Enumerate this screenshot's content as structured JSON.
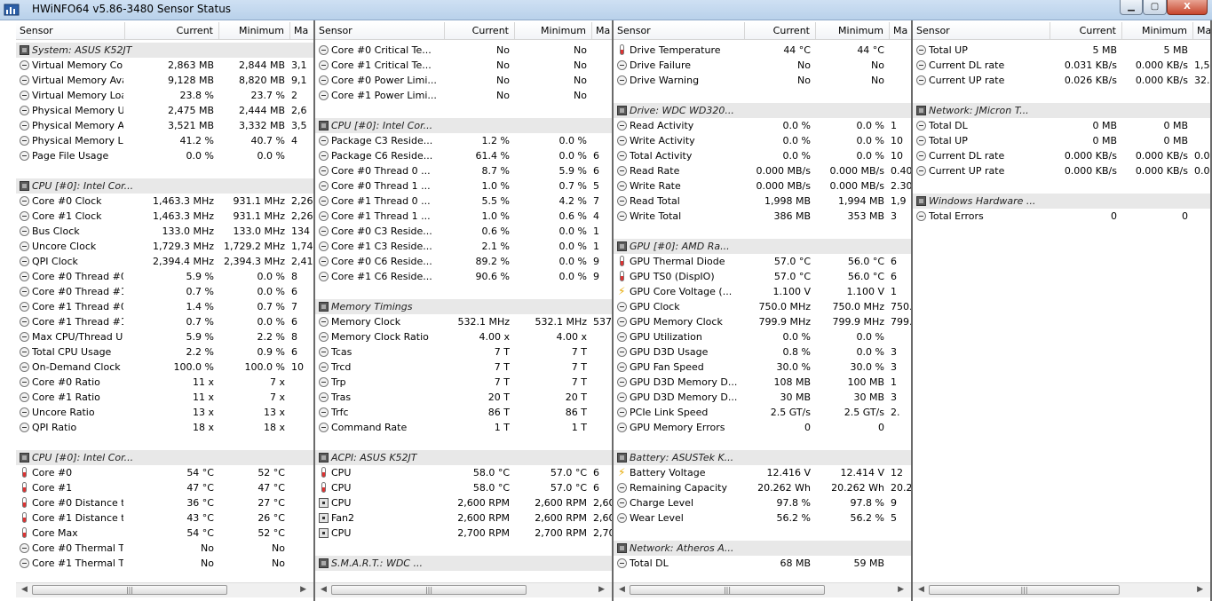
{
  "window": {
    "title": "HWiNFO64 v5.86-3480 Sensor Status",
    "min_label": "▁",
    "max_label": "▢",
    "close_label": "X"
  },
  "columns": [
    "Sensor",
    "Current",
    "Minimum",
    "Ma"
  ],
  "panels": [
    {
      "rows": [
        {
          "t": "g",
          "n": "System: ASUS K52JT",
          "i": "chip"
        },
        {
          "t": "s",
          "n": "Virtual Memory Com...",
          "c": "2,863 MB",
          "m": "2,844 MB",
          "x": "3,1",
          "i": "clock"
        },
        {
          "t": "s",
          "n": "Virtual Memory Avai...",
          "c": "9,128 MB",
          "m": "8,820 MB",
          "x": "9,1",
          "i": "clock"
        },
        {
          "t": "s",
          "n": "Virtual Memory Load",
          "c": "23.8 %",
          "m": "23.7 %",
          "x": "2",
          "i": "clock"
        },
        {
          "t": "s",
          "n": "Physical Memory Used",
          "c": "2,475 MB",
          "m": "2,444 MB",
          "x": "2,6",
          "i": "clock"
        },
        {
          "t": "s",
          "n": "Physical Memory Av...",
          "c": "3,521 MB",
          "m": "3,332 MB",
          "x": "3,5",
          "i": "clock"
        },
        {
          "t": "s",
          "n": "Physical Memory Load",
          "c": "41.2 %",
          "m": "40.7 %",
          "x": "4",
          "i": "clock"
        },
        {
          "t": "s",
          "n": "Page File Usage",
          "c": "0.0 %",
          "m": "0.0 %",
          "x": "",
          "i": "clock"
        },
        {
          "t": "e"
        },
        {
          "t": "g",
          "n": "CPU [#0]: Intel Cor...",
          "i": "chip"
        },
        {
          "t": "s",
          "n": "Core #0 Clock",
          "c": "1,463.3 MHz",
          "m": "931.1 MHz",
          "x": "2,261",
          "i": "clock"
        },
        {
          "t": "s",
          "n": "Core #1 Clock",
          "c": "1,463.3 MHz",
          "m": "931.1 MHz",
          "x": "2,261",
          "i": "clock"
        },
        {
          "t": "s",
          "n": "Bus Clock",
          "c": "133.0 MHz",
          "m": "133.0 MHz",
          "x": "134",
          "i": "clock"
        },
        {
          "t": "s",
          "n": "Uncore Clock",
          "c": "1,729.3 MHz",
          "m": "1,729.2 MHz",
          "x": "1,746",
          "i": "clock"
        },
        {
          "t": "s",
          "n": "QPI Clock",
          "c": "2,394.4 MHz",
          "m": "2,394.3 MHz",
          "x": "2,418",
          "i": "clock"
        },
        {
          "t": "s",
          "n": "Core #0 Thread #0...",
          "c": "5.9 %",
          "m": "0.0 %",
          "x": "8",
          "i": "clock"
        },
        {
          "t": "s",
          "n": "Core #0 Thread #1...",
          "c": "0.7 %",
          "m": "0.0 %",
          "x": "6",
          "i": "clock"
        },
        {
          "t": "s",
          "n": "Core #1 Thread #0...",
          "c": "1.4 %",
          "m": "0.7 %",
          "x": "7",
          "i": "clock"
        },
        {
          "t": "s",
          "n": "Core #1 Thread #1...",
          "c": "0.7 %",
          "m": "0.0 %",
          "x": "6",
          "i": "clock"
        },
        {
          "t": "s",
          "n": "Max CPU/Thread U...",
          "c": "5.9 %",
          "m": "2.2 %",
          "x": "8",
          "i": "clock"
        },
        {
          "t": "s",
          "n": "Total CPU Usage",
          "c": "2.2 %",
          "m": "0.9 %",
          "x": "6",
          "i": "clock"
        },
        {
          "t": "s",
          "n": "On-Demand Clock ...",
          "c": "100.0 %",
          "m": "100.0 %",
          "x": "10",
          "i": "clock"
        },
        {
          "t": "s",
          "n": "Core #0 Ratio",
          "c": "11 x",
          "m": "7 x",
          "x": "",
          "i": "clock"
        },
        {
          "t": "s",
          "n": "Core #1 Ratio",
          "c": "11 x",
          "m": "7 x",
          "x": "",
          "i": "clock"
        },
        {
          "t": "s",
          "n": "Uncore Ratio",
          "c": "13 x",
          "m": "13 x",
          "x": "",
          "i": "clock"
        },
        {
          "t": "s",
          "n": "QPI Ratio",
          "c": "18 x",
          "m": "18 x",
          "x": "",
          "i": "clock"
        },
        {
          "t": "e"
        },
        {
          "t": "g",
          "n": "CPU [#0]: Intel Cor...",
          "i": "chip"
        },
        {
          "t": "s",
          "n": "Core #0",
          "c": "54 °C",
          "m": "52 °C",
          "x": "",
          "i": "therm"
        },
        {
          "t": "s",
          "n": "Core #1",
          "c": "47 °C",
          "m": "47 °C",
          "x": "",
          "i": "therm"
        },
        {
          "t": "s",
          "n": "Core #0 Distance t...",
          "c": "36 °C",
          "m": "27 °C",
          "x": "",
          "i": "therm"
        },
        {
          "t": "s",
          "n": "Core #1 Distance t...",
          "c": "43 °C",
          "m": "26 °C",
          "x": "",
          "i": "therm"
        },
        {
          "t": "s",
          "n": "Core Max",
          "c": "54 °C",
          "m": "52 °C",
          "x": "",
          "i": "therm"
        },
        {
          "t": "s",
          "n": "Core #0 Thermal T...",
          "c": "No",
          "m": "No",
          "x": "",
          "i": "clock"
        },
        {
          "t": "s",
          "n": "Core #1 Thermal T...",
          "c": "No",
          "m": "No",
          "x": "",
          "i": "clock"
        }
      ]
    },
    {
      "rows": [
        {
          "t": "s",
          "n": "Core #0 Critical Te...",
          "c": "No",
          "m": "No",
          "x": "",
          "i": "clock"
        },
        {
          "t": "s",
          "n": "Core #1 Critical Te...",
          "c": "No",
          "m": "No",
          "x": "",
          "i": "clock"
        },
        {
          "t": "s",
          "n": "Core #0 Power Limi...",
          "c": "No",
          "m": "No",
          "x": "",
          "i": "clock"
        },
        {
          "t": "s",
          "n": "Core #1 Power Limi...",
          "c": "No",
          "m": "No",
          "x": "",
          "i": "clock"
        },
        {
          "t": "e"
        },
        {
          "t": "g",
          "n": "CPU [#0]: Intel Cor...",
          "i": "chip"
        },
        {
          "t": "s",
          "n": "Package C3 Reside...",
          "c": "1.2 %",
          "m": "0.0 %",
          "x": "",
          "i": "clock"
        },
        {
          "t": "s",
          "n": "Package C6 Reside...",
          "c": "61.4 %",
          "m": "0.0 %",
          "x": "6",
          "i": "clock"
        },
        {
          "t": "s",
          "n": "Core #0 Thread 0 ...",
          "c": "8.7 %",
          "m": "5.9 %",
          "x": "6",
          "i": "clock"
        },
        {
          "t": "s",
          "n": "Core #0 Thread 1 ...",
          "c": "1.0 %",
          "m": "0.7 %",
          "x": "5",
          "i": "clock"
        },
        {
          "t": "s",
          "n": "Core #1 Thread 0 ...",
          "c": "5.5 %",
          "m": "4.2 %",
          "x": "7",
          "i": "clock"
        },
        {
          "t": "s",
          "n": "Core #1 Thread 1 ...",
          "c": "1.0 %",
          "m": "0.6 %",
          "x": "4",
          "i": "clock"
        },
        {
          "t": "s",
          "n": "Core #0 C3 Reside...",
          "c": "0.6 %",
          "m": "0.0 %",
          "x": "1",
          "i": "clock"
        },
        {
          "t": "s",
          "n": "Core #1 C3 Reside...",
          "c": "2.1 %",
          "m": "0.0 %",
          "x": "1",
          "i": "clock"
        },
        {
          "t": "s",
          "n": "Core #0 C6 Reside...",
          "c": "89.2 %",
          "m": "0.0 %",
          "x": "9",
          "i": "clock"
        },
        {
          "t": "s",
          "n": "Core #1 C6 Reside...",
          "c": "90.6 %",
          "m": "0.0 %",
          "x": "9",
          "i": "clock"
        },
        {
          "t": "e"
        },
        {
          "t": "g",
          "n": "Memory Timings",
          "i": "chip"
        },
        {
          "t": "s",
          "n": "Memory Clock",
          "c": "532.1 MHz",
          "m": "532.1 MHz",
          "x": "537.",
          "i": "clock"
        },
        {
          "t": "s",
          "n": "Memory Clock Ratio",
          "c": "4.00 x",
          "m": "4.00 x",
          "x": "",
          "i": "clock"
        },
        {
          "t": "s",
          "n": "Tcas",
          "c": "7 T",
          "m": "7 T",
          "x": "",
          "i": "clock"
        },
        {
          "t": "s",
          "n": "Trcd",
          "c": "7 T",
          "m": "7 T",
          "x": "",
          "i": "clock"
        },
        {
          "t": "s",
          "n": "Trp",
          "c": "7 T",
          "m": "7 T",
          "x": "",
          "i": "clock"
        },
        {
          "t": "s",
          "n": "Tras",
          "c": "20 T",
          "m": "20 T",
          "x": "",
          "i": "clock"
        },
        {
          "t": "s",
          "n": "Trfc",
          "c": "86 T",
          "m": "86 T",
          "x": "",
          "i": "clock"
        },
        {
          "t": "s",
          "n": "Command Rate",
          "c": "1 T",
          "m": "1 T",
          "x": "",
          "i": "clock"
        },
        {
          "t": "e"
        },
        {
          "t": "g",
          "n": "ACPI: ASUS K52JT",
          "i": "chip"
        },
        {
          "t": "s",
          "n": "CPU",
          "c": "58.0 °C",
          "m": "57.0 °C",
          "x": "6",
          "i": "therm"
        },
        {
          "t": "s",
          "n": "CPU",
          "c": "58.0 °C",
          "m": "57.0 °C",
          "x": "6",
          "i": "therm"
        },
        {
          "t": "s",
          "n": "CPU",
          "c": "2,600 RPM",
          "m": "2,600 RPM",
          "x": "2,60",
          "i": "fan"
        },
        {
          "t": "s",
          "n": "Fan2",
          "c": "2,600 RPM",
          "m": "2,600 RPM",
          "x": "2,60",
          "i": "fan"
        },
        {
          "t": "s",
          "n": "CPU",
          "c": "2,700 RPM",
          "m": "2,700 RPM",
          "x": "2,70",
          "i": "fan"
        },
        {
          "t": "e"
        },
        {
          "t": "g",
          "n": "S.M.A.R.T.: WDC ...",
          "i": "chip"
        }
      ]
    },
    {
      "rows": [
        {
          "t": "s",
          "n": "Drive Temperature",
          "c": "44 °C",
          "m": "44 °C",
          "x": "",
          "i": "therm"
        },
        {
          "t": "s",
          "n": "Drive Failure",
          "c": "No",
          "m": "No",
          "x": "",
          "i": "clock"
        },
        {
          "t": "s",
          "n": "Drive Warning",
          "c": "No",
          "m": "No",
          "x": "",
          "i": "clock"
        },
        {
          "t": "e"
        },
        {
          "t": "g",
          "n": "Drive: WDC WD320...",
          "i": "chip"
        },
        {
          "t": "s",
          "n": "Read Activity",
          "c": "0.0 %",
          "m": "0.0 %",
          "x": "1",
          "i": "clock"
        },
        {
          "t": "s",
          "n": "Write Activity",
          "c": "0.0 %",
          "m": "0.0 %",
          "x": "10",
          "i": "clock"
        },
        {
          "t": "s",
          "n": "Total Activity",
          "c": "0.0 %",
          "m": "0.0 %",
          "x": "10",
          "i": "clock"
        },
        {
          "t": "s",
          "n": "Read Rate",
          "c": "0.000 MB/s",
          "m": "0.000 MB/s",
          "x": "0.40",
          "i": "clock"
        },
        {
          "t": "s",
          "n": "Write Rate",
          "c": "0.000 MB/s",
          "m": "0.000 MB/s",
          "x": "2.30",
          "i": "clock"
        },
        {
          "t": "s",
          "n": "Read Total",
          "c": "1,998 MB",
          "m": "1,994 MB",
          "x": "1,9",
          "i": "clock"
        },
        {
          "t": "s",
          "n": "Write Total",
          "c": "386 MB",
          "m": "353 MB",
          "x": "3",
          "i": "clock"
        },
        {
          "t": "e"
        },
        {
          "t": "g",
          "n": "GPU [#0]: AMD Ra...",
          "i": "chip"
        },
        {
          "t": "s",
          "n": "GPU Thermal Diode",
          "c": "57.0 °C",
          "m": "56.0 °C",
          "x": "6",
          "i": "therm"
        },
        {
          "t": "s",
          "n": "GPU TS0 (DispIO)",
          "c": "57.0 °C",
          "m": "56.0 °C",
          "x": "6",
          "i": "therm"
        },
        {
          "t": "s",
          "n": "GPU Core Voltage (...",
          "c": "1.100 V",
          "m": "1.100 V",
          "x": "1",
          "i": "volt"
        },
        {
          "t": "s",
          "n": "GPU Clock",
          "c": "750.0 MHz",
          "m": "750.0 MHz",
          "x": "750.",
          "i": "clock"
        },
        {
          "t": "s",
          "n": "GPU Memory Clock",
          "c": "799.9 MHz",
          "m": "799.9 MHz",
          "x": "799.",
          "i": "clock"
        },
        {
          "t": "s",
          "n": "GPU Utilization",
          "c": "0.0 %",
          "m": "0.0 %",
          "x": "",
          "i": "clock"
        },
        {
          "t": "s",
          "n": "GPU D3D Usage",
          "c": "0.8 %",
          "m": "0.0 %",
          "x": "3",
          "i": "clock"
        },
        {
          "t": "s",
          "n": "GPU Fan Speed",
          "c": "30.0 %",
          "m": "30.0 %",
          "x": "3",
          "i": "clock"
        },
        {
          "t": "s",
          "n": "GPU D3D Memory D...",
          "c": "108 MB",
          "m": "100 MB",
          "x": "1",
          "i": "clock"
        },
        {
          "t": "s",
          "n": "GPU D3D Memory D...",
          "c": "30 MB",
          "m": "30 MB",
          "x": "3",
          "i": "clock"
        },
        {
          "t": "s",
          "n": "PCIe Link Speed",
          "c": "2.5 GT/s",
          "m": "2.5 GT/s",
          "x": "2.",
          "i": "clock"
        },
        {
          "t": "s",
          "n": "GPU Memory Errors",
          "c": "0",
          "m": "0",
          "x": "",
          "i": "clock"
        },
        {
          "t": "e"
        },
        {
          "t": "g",
          "n": "Battery: ASUSTek K...",
          "i": "chip"
        },
        {
          "t": "s",
          "n": "Battery Voltage",
          "c": "12.416 V",
          "m": "12.414 V",
          "x": "12",
          "i": "volt"
        },
        {
          "t": "s",
          "n": "Remaining Capacity",
          "c": "20.262 Wh",
          "m": "20.262 Wh",
          "x": "20.2",
          "i": "clock"
        },
        {
          "t": "s",
          "n": "Charge Level",
          "c": "97.8 %",
          "m": "97.8 %",
          "x": "9",
          "i": "clock"
        },
        {
          "t": "s",
          "n": "Wear Level",
          "c": "56.2 %",
          "m": "56.2 %",
          "x": "5",
          "i": "clock"
        },
        {
          "t": "e"
        },
        {
          "t": "g",
          "n": "Network: Atheros A...",
          "i": "chip"
        },
        {
          "t": "s",
          "n": "Total DL",
          "c": "68 MB",
          "m": "59 MB",
          "x": "",
          "i": "clock"
        }
      ]
    },
    {
      "rows": [
        {
          "t": "s",
          "n": "Total UP",
          "c": "5 MB",
          "m": "5 MB",
          "x": "",
          "i": "clock"
        },
        {
          "t": "s",
          "n": "Current DL rate",
          "c": "0.031 KB/s",
          "m": "0.000 KB/s",
          "x": "1,514.2",
          "i": "clock"
        },
        {
          "t": "s",
          "n": "Current UP rate",
          "c": "0.026 KB/s",
          "m": "0.000 KB/s",
          "x": "32.02",
          "i": "clock"
        },
        {
          "t": "e"
        },
        {
          "t": "g",
          "n": "Network: JMicron T...",
          "i": "chip"
        },
        {
          "t": "s",
          "n": "Total DL",
          "c": "0 MB",
          "m": "0 MB",
          "x": "",
          "i": "clock"
        },
        {
          "t": "s",
          "n": "Total UP",
          "c": "0 MB",
          "m": "0 MB",
          "x": "",
          "i": "clock"
        },
        {
          "t": "s",
          "n": "Current DL rate",
          "c": "0.000 KB/s",
          "m": "0.000 KB/s",
          "x": "0.00",
          "i": "clock"
        },
        {
          "t": "s",
          "n": "Current UP rate",
          "c": "0.000 KB/s",
          "m": "0.000 KB/s",
          "x": "0.00",
          "i": "clock"
        },
        {
          "t": "e"
        },
        {
          "t": "g",
          "n": "Windows Hardware ...",
          "i": "chip"
        },
        {
          "t": "s",
          "n": "Total Errors",
          "c": "0",
          "m": "0",
          "x": "",
          "i": "clock"
        }
      ]
    }
  ]
}
